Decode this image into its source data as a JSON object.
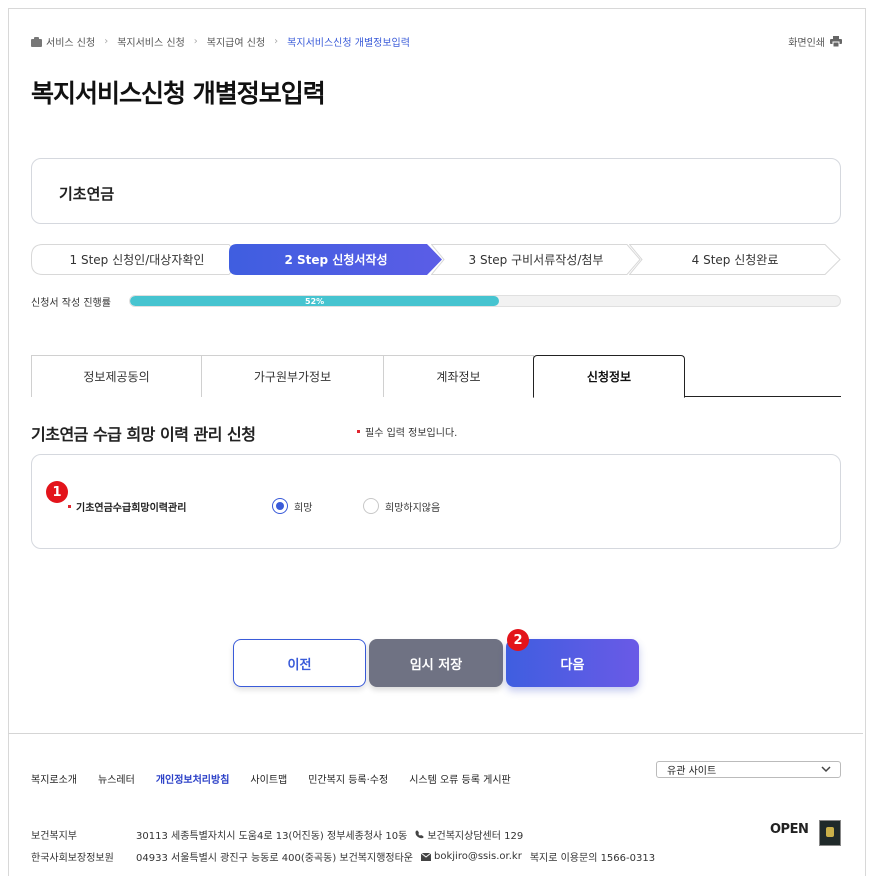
{
  "breadcrumb": {
    "items": [
      "서비스 신청",
      "복지서비스 신청",
      "복지급여 신청"
    ],
    "current": "복지서비스신청 개별정보입력"
  },
  "print_label": "화면인쇄",
  "page_title": "복지서비스신청 개별정보입력",
  "service_name": "기초연금",
  "steps": [
    {
      "label": "1 Step 신청인/대상자확인",
      "active": false
    },
    {
      "label": "2 Step 신청서작성",
      "active": true
    },
    {
      "label": "3 Step 구비서류작성/첨부",
      "active": false
    },
    {
      "label": "4 Step 신청완료",
      "active": false
    }
  ],
  "progress": {
    "label": "신청서 작성 진행률",
    "value": 52,
    "text": "52%"
  },
  "tabs": [
    "정보제공동의",
    "가구원부가정보",
    "계좌정보",
    "신청정보"
  ],
  "active_tab": 3,
  "section": {
    "title": "기초연금 수급 희망 이력 관리 신청",
    "required_note": "필수 입력 정보입니다.",
    "field_label": "기초연금수급희망이력관리",
    "options": [
      {
        "label": "희망",
        "checked": true
      },
      {
        "label": "희망하지않음",
        "checked": false
      }
    ]
  },
  "badges": [
    "1",
    "2"
  ],
  "buttons": {
    "prev": "이전",
    "temp_save": "임시 저장",
    "next": "다음"
  },
  "footer": {
    "links": [
      "복지로소개",
      "뉴스레터",
      "개인정보처리방침",
      "사이트맵",
      "민간복지 등록·수정",
      "시스템 오류 등록 게시판"
    ],
    "related_site": "유관 사이트",
    "rows": [
      {
        "org": "보건복지부",
        "address": "30113  세종특별자치시 도움4로 13(어진동) 정부세종청사 10동",
        "contact": "보건복지상담센터 129"
      },
      {
        "org": "한국사회보장정보원",
        "address": "04933 서울특별시 광진구 능동로 400(중곡동) 보건복지행정타운",
        "contact": "bokjiro@ssis.or.kr",
        "extra": "복지로 이용문의 1566-0313"
      }
    ],
    "open_logo": "OPEN"
  },
  "colors": {
    "accent": "#3a5bd9",
    "progress": "#46c4d0",
    "badge": "#e3141b",
    "temp_button": "#6f7283"
  }
}
